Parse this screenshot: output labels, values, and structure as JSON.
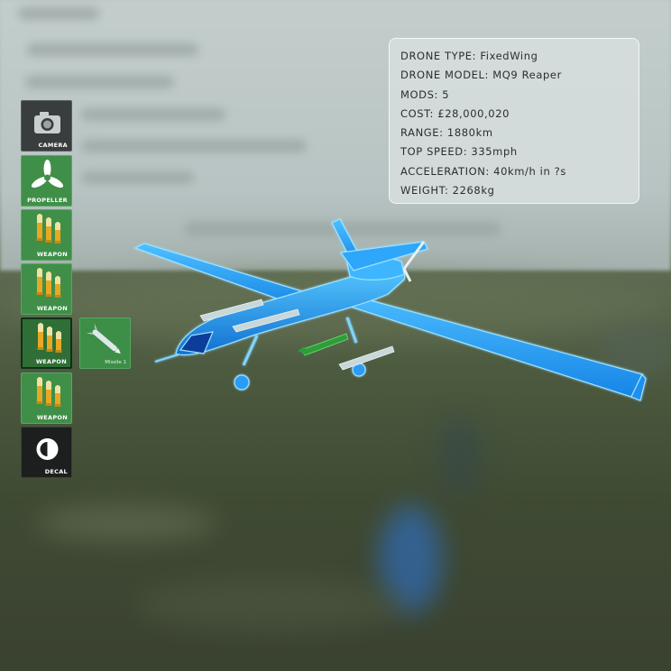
{
  "stats": {
    "drone_type": "DRONE TYPE: FixedWing",
    "drone_model": "DRONE MODEL: MQ9 Reaper",
    "mods": "MODS: 5",
    "cost": "COST: £28,000,020",
    "range": "RANGE: 1880km",
    "top_speed": "TOP SPEED: 335mph",
    "acceleration": "ACCELERATION: 40km/h in ?s",
    "weight": "WEIGHT: 2268kg"
  },
  "mod_slots": [
    {
      "label": "CAMERA",
      "icon": "camera-icon",
      "state": "default"
    },
    {
      "label": "PROPELLER",
      "icon": "propeller-icon",
      "state": "default"
    },
    {
      "label": "WEAPON",
      "icon": "bullets-icon",
      "state": "default"
    },
    {
      "label": "WEAPON",
      "icon": "bullets-icon",
      "state": "default"
    },
    {
      "label": "WEAPON",
      "icon": "bullets-icon",
      "state": "selected"
    },
    {
      "label": "WEAPON",
      "icon": "bullets-icon",
      "state": "default"
    },
    {
      "label": "DECAL",
      "icon": "decal-icon",
      "state": "default"
    }
  ],
  "weapon_option": {
    "label": "Missile 1",
    "icon": "missile-icon"
  },
  "colors": {
    "hologram": "#2aa8ff",
    "slot_green": "#3f8f48",
    "slot_dark": "#3a3d3d",
    "panel_bg": "#d6dddd"
  }
}
